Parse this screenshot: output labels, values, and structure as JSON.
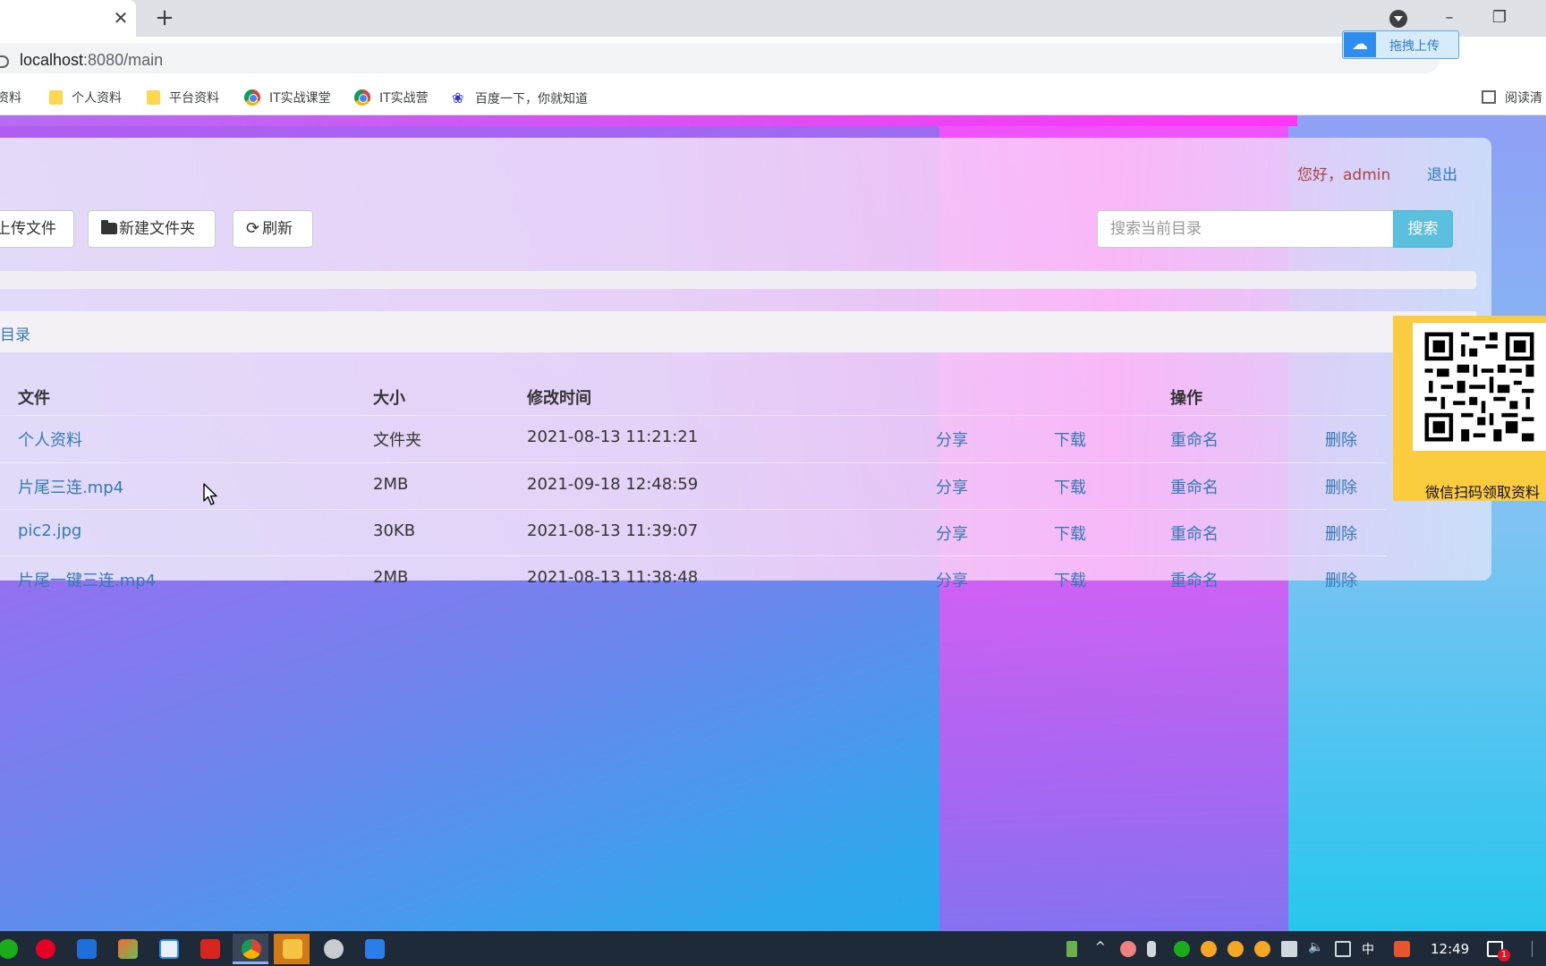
{
  "browser": {
    "tab_close_glyph": "✕",
    "new_tab_glyph": "+",
    "url_host": "localhost",
    "url_rest": ":8080/main",
    "extension_upload_label": "拖拽上传",
    "window": {
      "minimize": "–",
      "restore": "❐"
    }
  },
  "bookmarks": [
    {
      "label": "资料",
      "icon": "folder-icon"
    },
    {
      "label": "个人资料",
      "icon": "folder-icon"
    },
    {
      "label": "平台资料",
      "icon": "folder-icon"
    },
    {
      "label": "IT实战课堂",
      "icon": "chrome-icon"
    },
    {
      "label": "IT实战营",
      "icon": "chrome-icon"
    },
    {
      "label": "百度一下，你就知道",
      "icon": "baidu-icon"
    }
  ],
  "reading_mode_label": "阅读清",
  "header": {
    "greeting": "您好，admin",
    "logout": "退出"
  },
  "toolbar": {
    "upload_label": "上传文件",
    "new_folder_label": "新建文件夹",
    "refresh_label": "刷新",
    "refresh_glyph": "⟳"
  },
  "search": {
    "placeholder": "搜索当前目录",
    "button_label": "搜索"
  },
  "upload_progress": 0,
  "breadcrumb": "目录",
  "table": {
    "headers": {
      "file": "文件",
      "size": "大小",
      "modified": "修改时间",
      "actions": "操作"
    },
    "rows": [
      {
        "name": "个人资料",
        "size": "文件夹",
        "modified": "2021-08-13 11:21:21",
        "share": "分享",
        "download": "下载",
        "rename": "重命名",
        "delete": "删除"
      },
      {
        "name": "片尾三连.mp4",
        "size": "2MB",
        "modified": "2021-09-18 12:48:59",
        "share": "分享",
        "download": "下载",
        "rename": "重命名",
        "delete": "删除"
      },
      {
        "name": "pic2.jpg",
        "size": "30KB",
        "modified": "2021-08-13 11:39:07",
        "share": "分享",
        "download": "下载",
        "rename": "重命名",
        "delete": "删除"
      },
      {
        "name": "片尾一键三连.mp4",
        "size": "2MB",
        "modified": "2021-08-13 11:38:48",
        "share": "分享",
        "download": "下载",
        "rename": "重命名",
        "delete": "删除"
      }
    ]
  },
  "qr_ad": {
    "caption": "微信扫码领取资料"
  },
  "taskbar": {
    "clock": "12:49",
    "ime": "中",
    "notification_count": "1"
  },
  "colors": {
    "link": "#337ab7",
    "greeting": "#a94442",
    "search_button": "#5bc0de"
  }
}
